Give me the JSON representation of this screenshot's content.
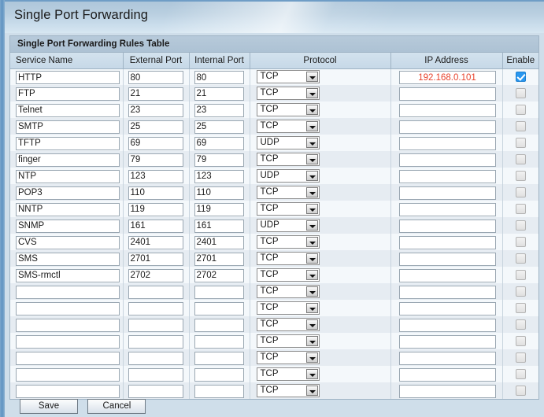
{
  "page": {
    "title": "Single Port Forwarding"
  },
  "panel": {
    "title": "Single Port Forwarding Rules Table"
  },
  "table": {
    "columns": [
      {
        "key": "service_name",
        "label": "Service Name",
        "align": "left"
      },
      {
        "key": "external_port",
        "label": "External Port",
        "align": "center"
      },
      {
        "key": "internal_port",
        "label": "Internal Port",
        "align": "center"
      },
      {
        "key": "protocol",
        "label": "Protocol",
        "align": "center"
      },
      {
        "key": "ip_address",
        "label": "IP Address",
        "align": "center"
      },
      {
        "key": "enable",
        "label": "Enable",
        "align": "center"
      }
    ],
    "protocol_options": [
      "TCP",
      "UDP"
    ],
    "input_placeholder": "",
    "rows": [
      {
        "service_name": "HTTP",
        "external_port": "80",
        "internal_port": "80",
        "protocol": "TCP",
        "ip_address": "192.168.0.101",
        "enable": true
      },
      {
        "service_name": "FTP",
        "external_port": "21",
        "internal_port": "21",
        "protocol": "TCP",
        "ip_address": "",
        "enable": false
      },
      {
        "service_name": "Telnet",
        "external_port": "23",
        "internal_port": "23",
        "protocol": "TCP",
        "ip_address": "",
        "enable": false
      },
      {
        "service_name": "SMTP",
        "external_port": "25",
        "internal_port": "25",
        "protocol": "TCP",
        "ip_address": "",
        "enable": false
      },
      {
        "service_name": "TFTP",
        "external_port": "69",
        "internal_port": "69",
        "protocol": "UDP",
        "ip_address": "",
        "enable": false
      },
      {
        "service_name": "finger",
        "external_port": "79",
        "internal_port": "79",
        "protocol": "TCP",
        "ip_address": "",
        "enable": false
      },
      {
        "service_name": "NTP",
        "external_port": "123",
        "internal_port": "123",
        "protocol": "UDP",
        "ip_address": "",
        "enable": false
      },
      {
        "service_name": "POP3",
        "external_port": "110",
        "internal_port": "110",
        "protocol": "TCP",
        "ip_address": "",
        "enable": false
      },
      {
        "service_name": "NNTP",
        "external_port": "119",
        "internal_port": "119",
        "protocol": "TCP",
        "ip_address": "",
        "enable": false
      },
      {
        "service_name": "SNMP",
        "external_port": "161",
        "internal_port": "161",
        "protocol": "UDP",
        "ip_address": "",
        "enable": false
      },
      {
        "service_name": "CVS",
        "external_port": "2401",
        "internal_port": "2401",
        "protocol": "TCP",
        "ip_address": "",
        "enable": false
      },
      {
        "service_name": "SMS",
        "external_port": "2701",
        "internal_port": "2701",
        "protocol": "TCP",
        "ip_address": "",
        "enable": false
      },
      {
        "service_name": "SMS-rmctl",
        "external_port": "2702",
        "internal_port": "2702",
        "protocol": "TCP",
        "ip_address": "",
        "enable": false
      },
      {
        "service_name": "",
        "external_port": "",
        "internal_port": "",
        "protocol": "TCP",
        "ip_address": "",
        "enable": false
      },
      {
        "service_name": "",
        "external_port": "",
        "internal_port": "",
        "protocol": "TCP",
        "ip_address": "",
        "enable": false
      },
      {
        "service_name": "",
        "external_port": "",
        "internal_port": "",
        "protocol": "TCP",
        "ip_address": "",
        "enable": false
      },
      {
        "service_name": "",
        "external_port": "",
        "internal_port": "",
        "protocol": "TCP",
        "ip_address": "",
        "enable": false
      },
      {
        "service_name": "",
        "external_port": "",
        "internal_port": "",
        "protocol": "TCP",
        "ip_address": "",
        "enable": false
      },
      {
        "service_name": "",
        "external_port": "",
        "internal_port": "",
        "protocol": "TCP",
        "ip_address": "",
        "enable": false
      },
      {
        "service_name": "",
        "external_port": "",
        "internal_port": "",
        "protocol": "TCP",
        "ip_address": "",
        "enable": false
      }
    ]
  },
  "buttons": {
    "save_label": "Save",
    "cancel_label": "Cancel"
  },
  "colors": {
    "header_blue": "#aec6da",
    "panel_title_bar": "#b2c7d8",
    "column_header": "#c9dbe9",
    "row_even": "#e6ecf2",
    "row_odd": "#f4f8fb",
    "ip_text_red": "#e8412a",
    "checkbox_checked": "#2a97ef",
    "left_edge_blue": "#6f9dc6"
  }
}
